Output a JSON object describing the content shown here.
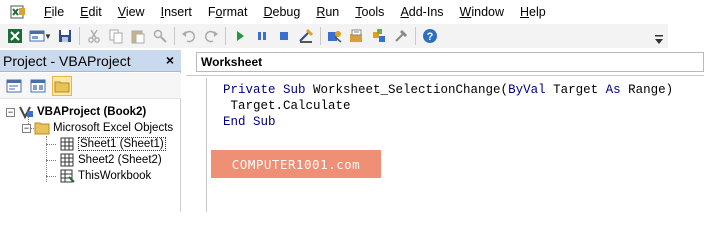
{
  "menubar": {
    "app_icon": "excel-vba-icon",
    "items": [
      {
        "underline": "F",
        "rest": "ile"
      },
      {
        "underline": "E",
        "rest": "dit"
      },
      {
        "underline": "V",
        "rest": "iew"
      },
      {
        "underline": "I",
        "rest": "nsert"
      },
      {
        "pre": "F",
        "underline": "o",
        "rest": "rmat"
      },
      {
        "underline": "D",
        "rest": "ebug"
      },
      {
        "underline": "R",
        "rest": "un"
      },
      {
        "underline": "T",
        "rest": "ools"
      },
      {
        "underline": "A",
        "rest": "dd-Ins"
      },
      {
        "underline": "W",
        "rest": "indow"
      },
      {
        "underline": "H",
        "rest": "elp"
      }
    ]
  },
  "toolbar": {
    "icons": [
      "excel-view-icon",
      "insert-module-icon",
      "save-icon",
      "cut-icon",
      "copy-icon",
      "paste-icon",
      "find-icon",
      "undo-icon",
      "redo-icon",
      "run-icon",
      "break-icon",
      "reset-icon",
      "design-mode-icon",
      "project-explorer-icon",
      "properties-icon",
      "object-browser-icon",
      "toolbox-icon",
      "help-icon"
    ]
  },
  "project": {
    "title": "Project - VBAProject",
    "close_glyph": "×",
    "tree": {
      "root": "VBAProject (Book2)",
      "folder": "Microsoft Excel Objects",
      "items": [
        "Sheet1 (Sheet1)",
        "Sheet2 (Sheet2)",
        "ThisWorkbook"
      ]
    }
  },
  "code": {
    "object_combo_value": "Worksheet",
    "line1_kw1": "Private Sub",
    "line1_mid": " Worksheet_SelectionChange(",
    "line1_kw2": "ByVal",
    "line1_mid2": " Target ",
    "line1_kw3": "As",
    "line1_end": " Range)",
    "line2": " Target.Calculate",
    "line3_kw": "End Sub"
  },
  "watermark": "COMPUTER1001.com",
  "colors": {
    "keyword": "#00007f",
    "title_bar": "#c9d9ee",
    "watermark_bg": "#ef8f76"
  }
}
